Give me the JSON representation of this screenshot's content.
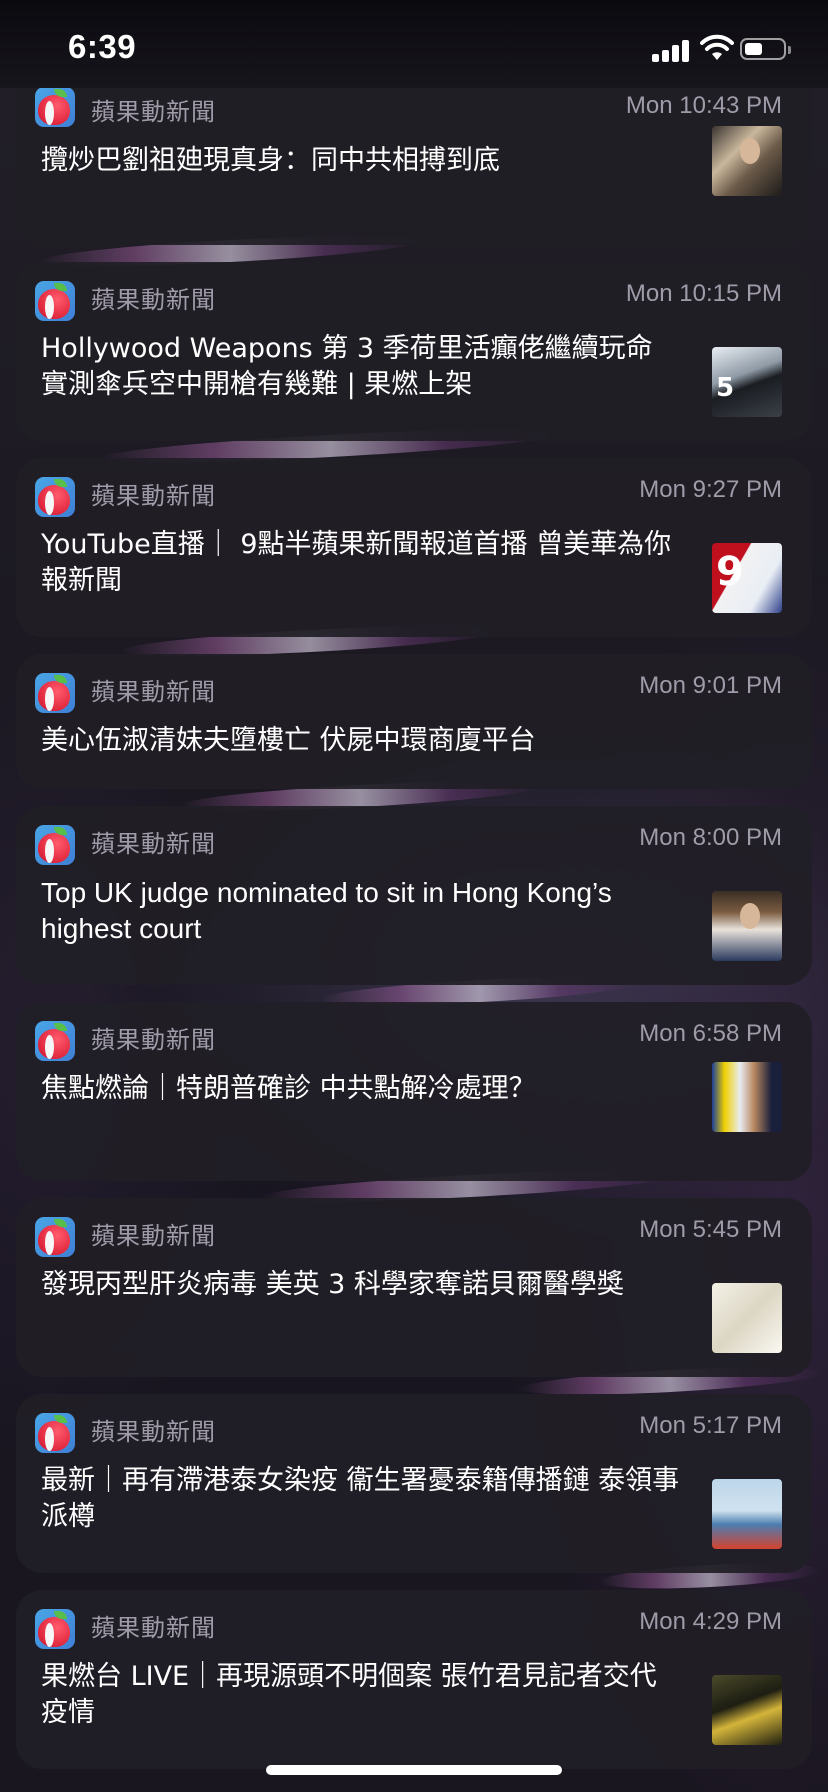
{
  "status_bar": {
    "time": "6:39"
  },
  "icons": {
    "signal": "cellular-signal-icon",
    "wifi": "wifi-icon",
    "battery": "battery-icon",
    "app": "apple-daily-app-icon"
  },
  "colors": {
    "card_background": "#201e26",
    "secondary_text": "#a09ba9",
    "primary_text": "#ffffff"
  },
  "notifications": [
    {
      "app": "蘋果動新聞",
      "time": "Mon 10:43 PM",
      "headline": "攬炒巴劉祖廸現真身：同中共相搏到底"
    },
    {
      "app": "蘋果動新聞",
      "time": "Mon 10:15 PM",
      "headline": "Hollywood Weapons 第 3 季荷里活癲佬繼續玩命 實測傘兵空中開槍有幾難 | 果燃上架"
    },
    {
      "app": "蘋果動新聞",
      "time": "Mon 9:27 PM",
      "headline": "YouTube直播｜ 9點半蘋果新聞報道首播 曾美華為你報新聞"
    },
    {
      "app": "蘋果動新聞",
      "time": "Mon 9:01 PM",
      "headline": "美心伍淑清妹夫墮樓亡 伏屍中環商廈平台"
    },
    {
      "app": "蘋果動新聞",
      "time": "Mon 8:00 PM",
      "headline": "Top UK judge nominated to sit in Hong Kong’s highest court"
    },
    {
      "app": "蘋果動新聞",
      "time": "Mon 6:58 PM",
      "headline": "焦點燃論｜特朗普確診 中共點解冷處理？"
    },
    {
      "app": "蘋果動新聞",
      "time": "Mon 5:45 PM",
      "headline": "發現丙型肝炎病毒 美英 3 科學家奪諾貝爾醫學獎"
    },
    {
      "app": "蘋果動新聞",
      "time": "Mon 5:17 PM",
      "headline": "最新｜再有滯港泰女染疫 衞生署憂泰籍傳播鏈 泰領事派樽"
    },
    {
      "app": "蘋果動新聞",
      "time": "Mon 4:29 PM",
      "headline": "果燃台 LIVE｜再現源頭不明個案 張竹君見記者交代疫情"
    }
  ]
}
